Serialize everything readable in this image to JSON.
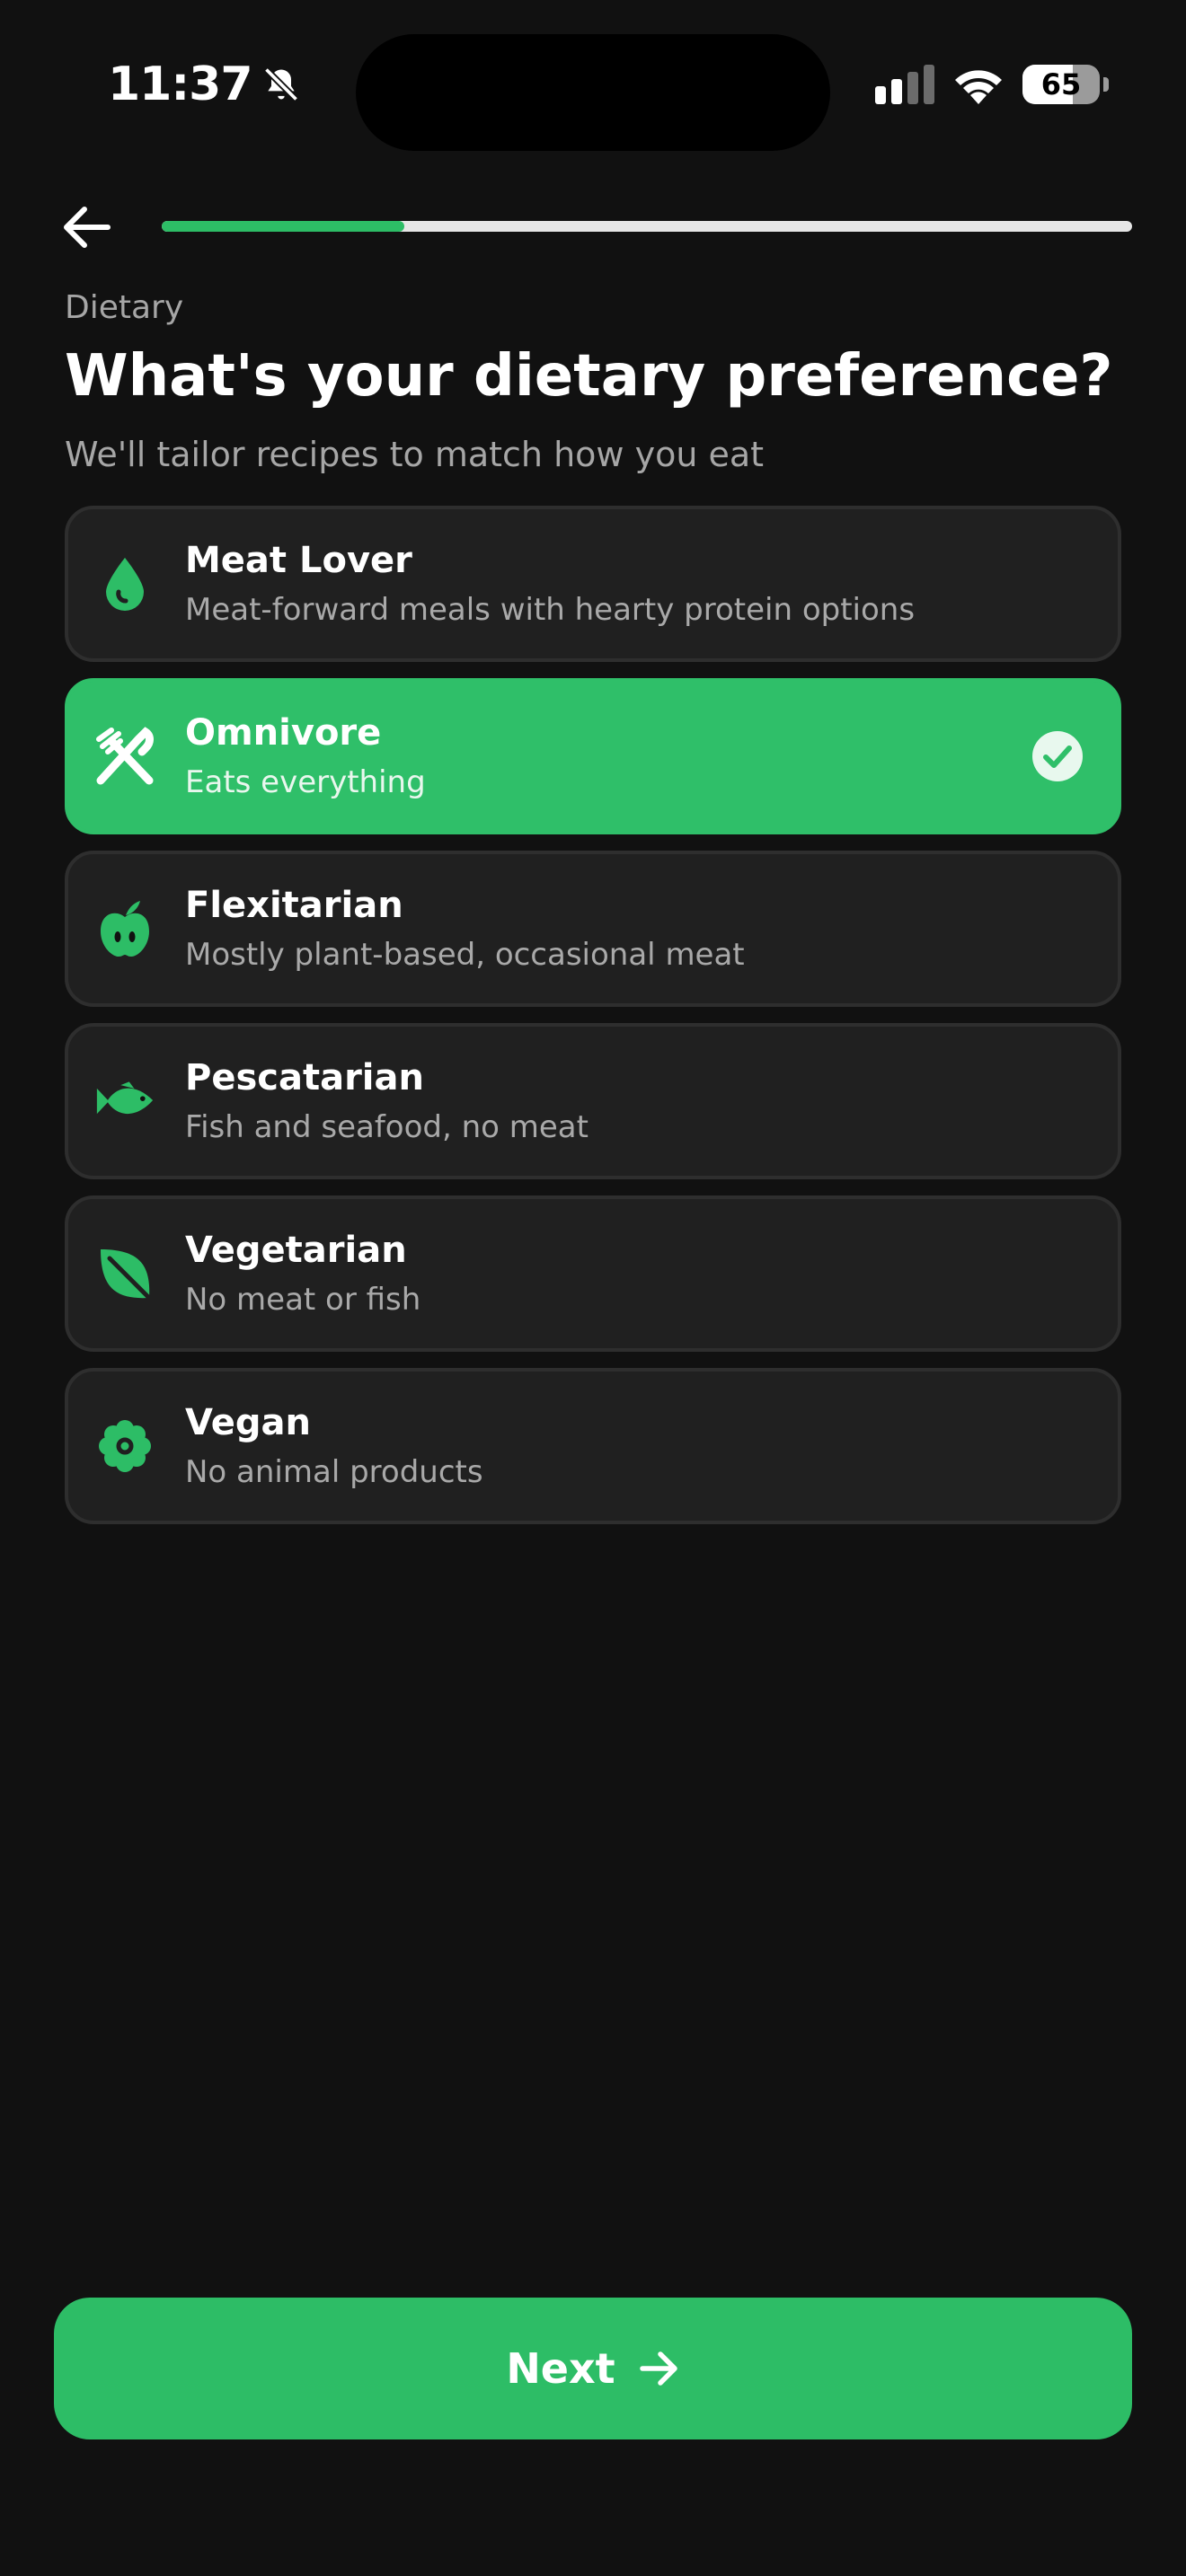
{
  "status_bar": {
    "time": "11:37",
    "battery": "65",
    "battery_level": 0.65
  },
  "header": {
    "progress": 0.25
  },
  "step_label": "Dietary",
  "title": "What's your dietary preference?",
  "subtitle": "We'll tailor recipes to match how you eat",
  "options": [
    {
      "title": "Meat Lover",
      "description": "Meat-forward meals with hearty protein options",
      "icon": "drop-icon",
      "selected": false
    },
    {
      "title": "Omnivore",
      "description": "Eats everything",
      "icon": "utensils-icon",
      "selected": true
    },
    {
      "title": "Flexitarian",
      "description": "Mostly plant-based, occasional meat",
      "icon": "apple-icon",
      "selected": false
    },
    {
      "title": "Pescatarian",
      "description": "Fish and seafood, no meat",
      "icon": "fish-icon",
      "selected": false
    },
    {
      "title": "Vegetarian",
      "description": "No meat or fish",
      "icon": "leaf-icon",
      "selected": false
    },
    {
      "title": "Vegan",
      "description": "No animal products",
      "icon": "flower-icon",
      "selected": false
    }
  ],
  "next_button": {
    "label": "Next",
    "icon": "arrow-right-icon"
  },
  "colors": {
    "background": "#111111",
    "accent": "#2dbd66",
    "card": "#202020",
    "card_border": "#2e2e2e",
    "muted_text": "#a6a6a6"
  }
}
